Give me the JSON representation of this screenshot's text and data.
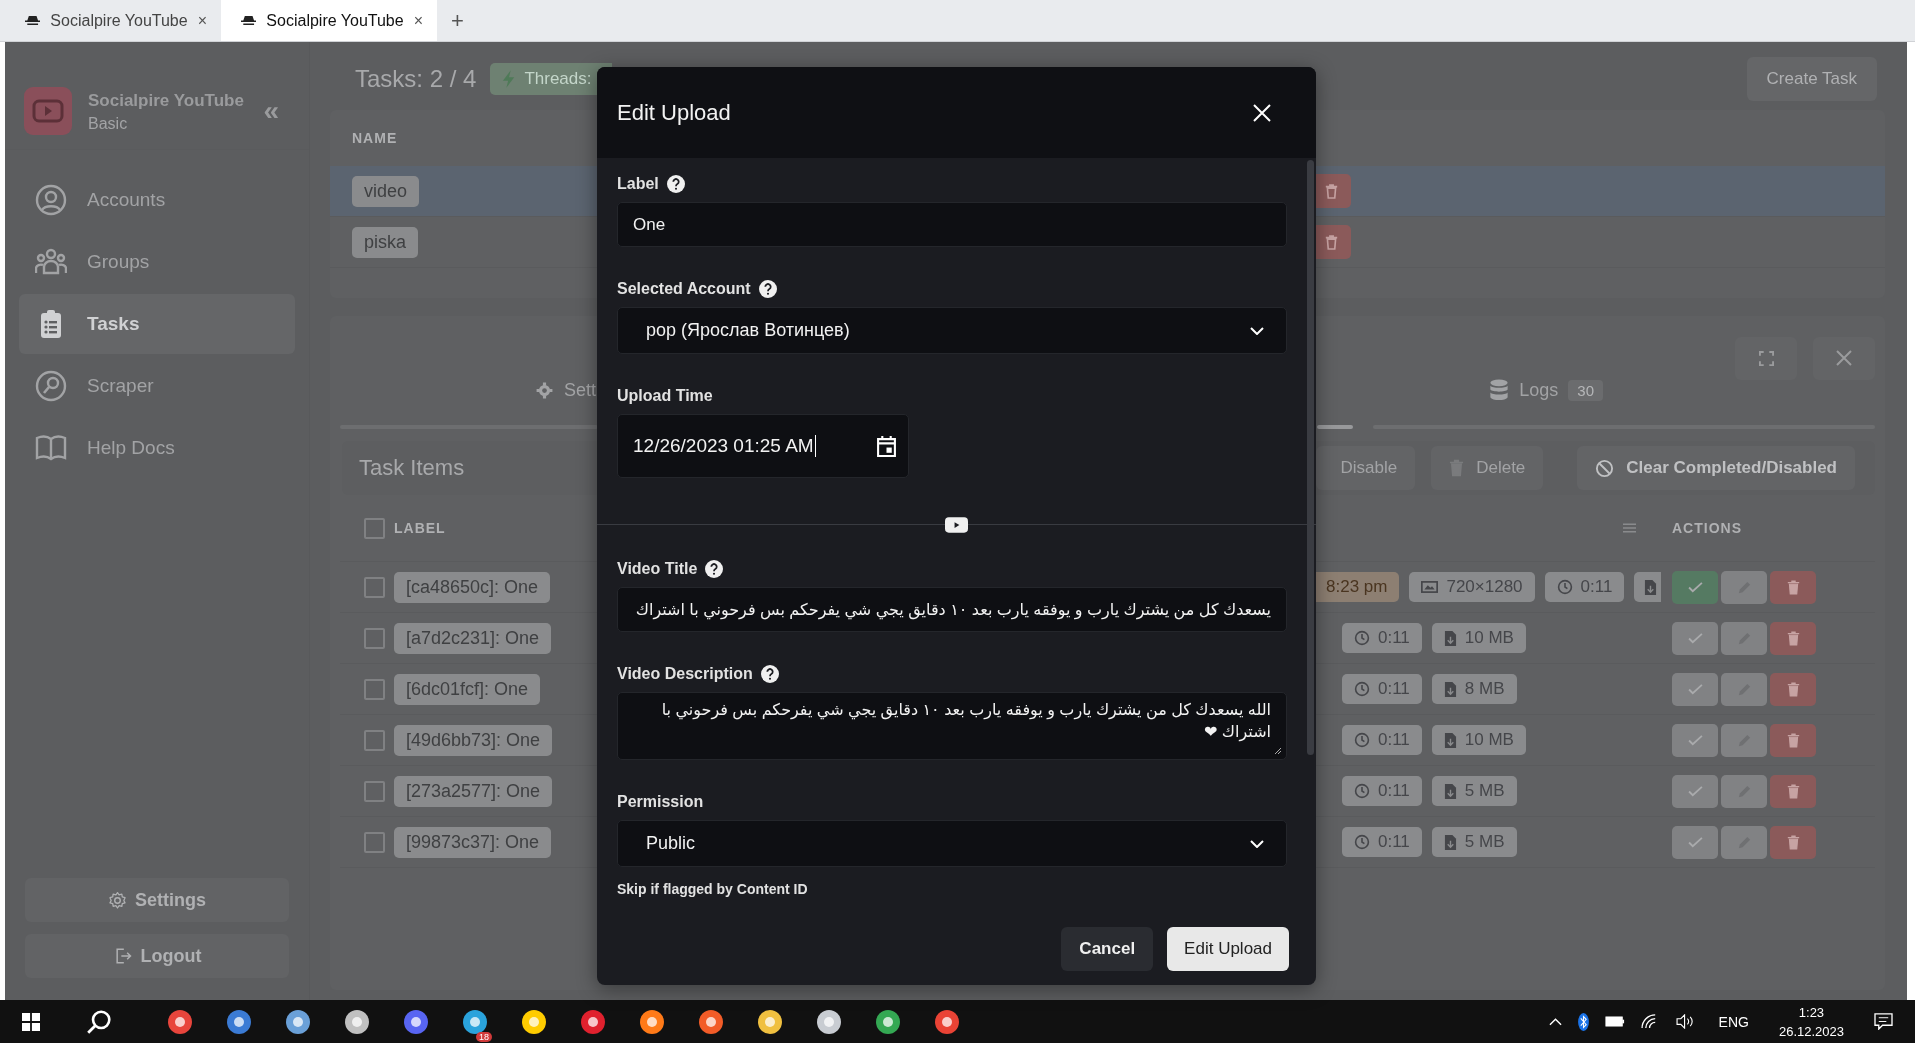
{
  "browser_tabs": [
    {
      "title": "Socialpire YouTube",
      "close": "×",
      "selected": false
    },
    {
      "title": "Socialpire YouTube",
      "close": "×",
      "selected": true
    }
  ],
  "new_tab": "+",
  "sidebar": {
    "app_name": "Socialpire YouTube",
    "plan": "Basic",
    "collapse": "«",
    "items": [
      {
        "label": "Accounts",
        "selected": false
      },
      {
        "label": "Groups",
        "selected": false
      },
      {
        "label": "Tasks",
        "selected": true
      },
      {
        "label": "Scraper",
        "selected": false
      },
      {
        "label": "Help Docs",
        "selected": false
      }
    ],
    "settings": "Settings",
    "logout": "Logout"
  },
  "header": {
    "title": "Tasks: 2 / 4",
    "threads": "Threads:",
    "create": "Create Task"
  },
  "tasks_table": {
    "column": "NAME",
    "rows": [
      {
        "name": "video",
        "selected": true
      },
      {
        "name": "piska",
        "selected": false
      }
    ]
  },
  "panel": {
    "settings_tab": {
      "label": "Sett",
      "selected": false
    },
    "logs_tab": {
      "label": "Logs",
      "count": "30",
      "selected": false
    },
    "title": "Task Items",
    "actions": [
      "Disable",
      "Delete",
      "Clear Completed/Disabled"
    ],
    "select_all": {
      "checked": false
    },
    "label_column": "LABEL",
    "actions_column": "ACTIONS",
    "rows": [
      {
        "label": "[ca48650c]: One",
        "checked": false,
        "completed": true,
        "chips": [
          {
            "kind": "time",
            "text": "8:23 pm"
          },
          {
            "kind": "resolution",
            "text": "720×1280"
          },
          {
            "kind": "duration",
            "text": "0:11"
          },
          {
            "kind": "size"
          }
        ]
      },
      {
        "label": "[a7d2c231]: One",
        "checked": false,
        "completed": false,
        "chips": [
          {
            "kind": "duration",
            "text": "0:11"
          },
          {
            "kind": "size",
            "text": "10 MB"
          }
        ]
      },
      {
        "label": "[6dc01fcf]: One",
        "checked": false,
        "completed": false,
        "chips": [
          {
            "kind": "duration",
            "text": "0:11"
          },
          {
            "kind": "size",
            "text": "8 MB"
          }
        ]
      },
      {
        "label": "[49d6bb73]: One",
        "checked": false,
        "completed": false,
        "chips": [
          {
            "kind": "duration",
            "text": "0:11"
          },
          {
            "kind": "size",
            "text": "10 MB"
          }
        ]
      },
      {
        "label": "[273a2577]: One",
        "checked": false,
        "completed": false,
        "chips": [
          {
            "kind": "duration",
            "text": "0:11"
          },
          {
            "kind": "size",
            "text": "5 MB"
          }
        ]
      },
      {
        "label": "[99873c37]: One",
        "checked": false,
        "completed": false,
        "chips": [
          {
            "kind": "duration",
            "text": "0:11"
          },
          {
            "kind": "size",
            "text": "5 MB"
          }
        ]
      }
    ]
  },
  "dialog": {
    "title": "Edit Upload",
    "fields_top": [
      {
        "kind": "text",
        "label": "Label",
        "help": true,
        "value": "One"
      },
      {
        "kind": "select",
        "label": "Selected Account",
        "help": true,
        "value": "pop (Ярослав Вотинцев)"
      },
      {
        "kind": "datetime",
        "label": "Upload Time",
        "help": false,
        "value": "12/26/2023 01:25 AM"
      }
    ],
    "fields_bottom": [
      {
        "kind": "text",
        "label": "Video Title",
        "help": true,
        "value": "يسعدك كل من يشترك يارب و يوفقه يارب بعد ١٠ دقايق يجي شي يفرحكم بس فرحوني با اشتراك"
      },
      {
        "kind": "textarea",
        "label": "Video Description",
        "help": true,
        "value": "الله يسعدك كل من يشترك يارب و يوفقه يارب بعد ١٠ دقايق يجي شي يفرحكم بس فرحوني با اشتراك ❤"
      },
      {
        "kind": "select",
        "label": "Permission",
        "help": false,
        "value": "Public"
      }
    ],
    "next_label": "Skip if flagged by Content ID",
    "buttons": [
      {
        "label": "Cancel",
        "kind": "secondary"
      },
      {
        "label": "Edit Upload",
        "kind": "primary"
      }
    ]
  },
  "taskbar": {
    "app_badge": "18",
    "language": "ENG",
    "time": "1:23",
    "date": "26.12.2023"
  }
}
